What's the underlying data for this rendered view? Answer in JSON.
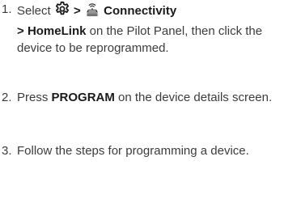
{
  "steps": [
    {
      "number": "1.",
      "select": "Select",
      "sep1": ">",
      "settings_icon": "gear-icon",
      "connectivity_icon": "connectivity-icon",
      "connectivity": "Connectivity",
      "sep2": ">",
      "homelink": "HomeLink",
      "rest": "on the Pilot Panel, then click the device to be reprogrammed."
    },
    {
      "number": "2.",
      "press": "Press",
      "program": "PROGRAM",
      "rest": "on the device details screen."
    },
    {
      "number": "3.",
      "text": "Follow the steps for programming a device."
    }
  ]
}
